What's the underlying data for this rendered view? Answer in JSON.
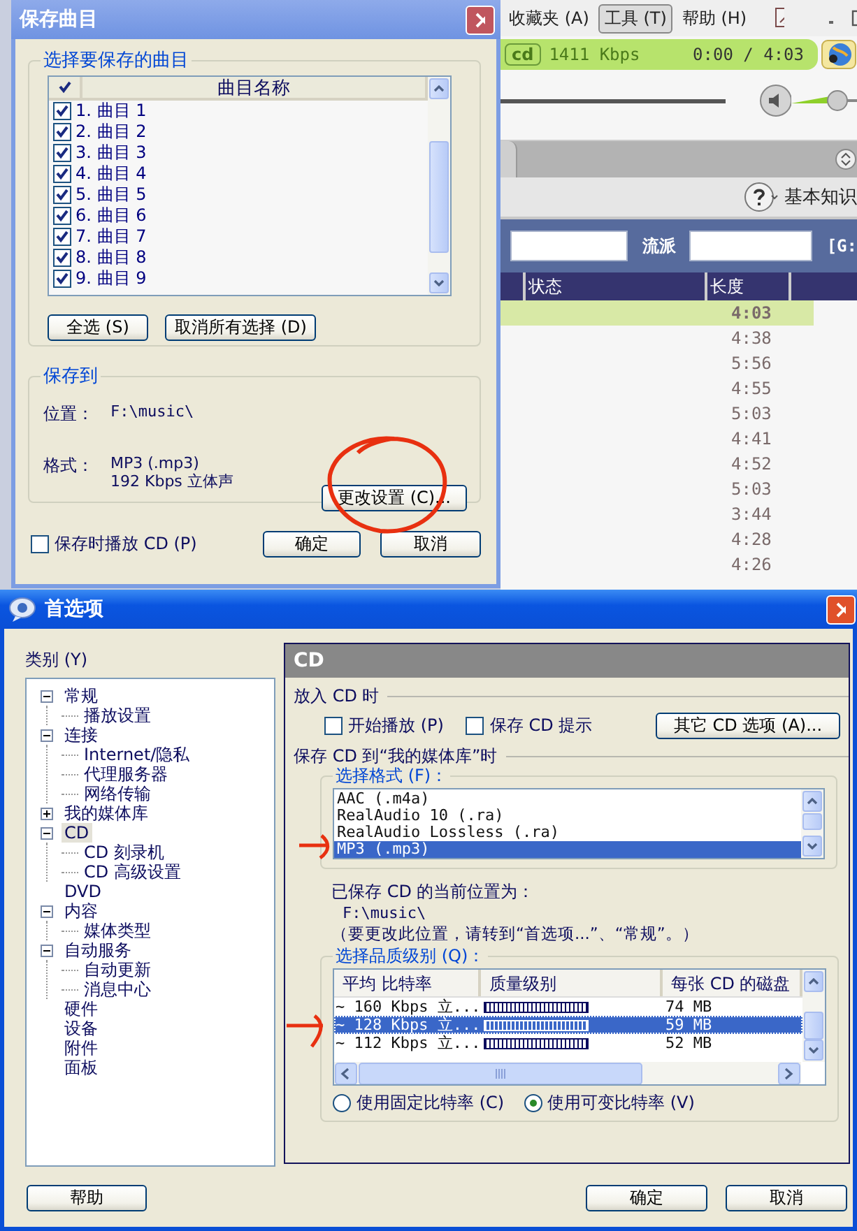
{
  "player": {
    "menu": [
      {
        "label": "收藏夹 (A)",
        "selected": false
      },
      {
        "label": "工具 (T)",
        "selected": true
      },
      {
        "label": "帮助 (H)",
        "selected": false
      }
    ],
    "now_playing": {
      "source": "cd",
      "bitrate": "1411 Kbps",
      "time": "0:00 / 4:03"
    },
    "help_label": "基本知识",
    "filter_label": "流派",
    "drive_label": "[G:",
    "table": {
      "columns": [
        "状态",
        "长度"
      ],
      "rows": [
        {
          "length": "4:03",
          "selected": true
        },
        {
          "length": "4:38",
          "selected": false
        },
        {
          "length": "5:56",
          "selected": false
        },
        {
          "length": "4:55",
          "selected": false
        },
        {
          "length": "5:03",
          "selected": false
        },
        {
          "length": "4:41",
          "selected": false
        },
        {
          "length": "4:52",
          "selected": false
        },
        {
          "length": "5:03",
          "selected": false
        },
        {
          "length": "3:44",
          "selected": false
        },
        {
          "length": "4:28",
          "selected": false
        },
        {
          "length": "4:26",
          "selected": false
        }
      ]
    }
  },
  "save_dialog": {
    "title": "保存曲目",
    "tracks_group": "选择要保存的曲目",
    "list_header": "曲目名称",
    "tracks": [
      {
        "label": "1. 曲目 1",
        "checked": true
      },
      {
        "label": "2. 曲目 2",
        "checked": true
      },
      {
        "label": "3. 曲目 3",
        "checked": true
      },
      {
        "label": "4. 曲目 4",
        "checked": true
      },
      {
        "label": "5. 曲目 5",
        "checked": true
      },
      {
        "label": "6. 曲目 6",
        "checked": true
      },
      {
        "label": "7. 曲目 7",
        "checked": true
      },
      {
        "label": "8. 曲目 8",
        "checked": true
      },
      {
        "label": "9. 曲目 9",
        "checked": true
      }
    ],
    "select_all": "全选 (S)",
    "deselect_all": "取消所有选择 (D)",
    "save_group": "保存到",
    "location_label": "位置：",
    "location": "F:\\music\\",
    "format_label": "格式：",
    "format": [
      "MP3 (.mp3)",
      "192 Kbps 立体声"
    ],
    "change_button": "更改设置 (C)...",
    "play_while_saving": {
      "label": "保存时播放 CD (P)",
      "checked": false
    },
    "ok": "确定",
    "cancel": "取消"
  },
  "preferences": {
    "title": "首选项",
    "category_label": "类别 (Y)",
    "tree": [
      {
        "label": "常规",
        "selected": false,
        "expanded": true,
        "children": [
          {
            "label": "播放设置",
            "selected": false
          }
        ]
      },
      {
        "label": "连接",
        "selected": false,
        "expanded": true,
        "children": [
          {
            "label": "Internet/隐私",
            "selected": false
          },
          {
            "label": "代理服务器",
            "selected": false
          },
          {
            "label": "网络传输",
            "selected": false
          }
        ]
      },
      {
        "label": "我的媒体库",
        "selected": false,
        "expanded": false
      },
      {
        "label": "CD",
        "selected": true,
        "expanded": true,
        "children": [
          {
            "label": "CD 刻录机",
            "selected": false
          },
          {
            "label": "CD 高级设置",
            "selected": false
          }
        ]
      },
      {
        "label": "DVD",
        "selected": false
      },
      {
        "label": "内容",
        "selected": false,
        "expanded": true,
        "children": [
          {
            "label": "媒体类型",
            "selected": false
          }
        ]
      },
      {
        "label": "自动服务",
        "selected": false,
        "expanded": true,
        "children": [
          {
            "label": "自动更新",
            "selected": false
          },
          {
            "label": "消息中心",
            "selected": false
          }
        ]
      },
      {
        "label": "硬件",
        "selected": false
      },
      {
        "label": "设备",
        "selected": false
      },
      {
        "label": "附件",
        "selected": false
      },
      {
        "label": "面板",
        "selected": false
      }
    ],
    "panel_title": "CD",
    "insert_section": "放入 CD 时",
    "insert_options": [
      {
        "label": "开始播放 (P)",
        "checked": false
      },
      {
        "label": "保存 CD 提示",
        "checked": false
      }
    ],
    "other_options_button": "其它 CD 选项 (A)...",
    "save_section": "保存 CD 到“我的媒体库”时",
    "format_group": "选择格式 (F)：",
    "formats": [
      {
        "label": "AAC (.m4a)",
        "selected": false
      },
      {
        "label": "RealAudio 10 (.ra)",
        "selected": false
      },
      {
        "label": "RealAudio Lossless (.ra)",
        "selected": false
      },
      {
        "label": "MP3 (.mp3)",
        "selected": true
      }
    ],
    "location_heading": "已保存 CD 的当前位置为：",
    "location": "F:\\music\\",
    "location_note": "（要更改此位置，请转到“首选项...”、“常规”。）",
    "quality_group": "选择品质级别 (Q)：",
    "quality_columns": [
      "平均 比特率",
      "质量级别",
      "每张 CD 的磁盘"
    ],
    "quality_rows": [
      {
        "bitrate": "~ 160 Kbps 立...",
        "size": "74 MB",
        "selected": false
      },
      {
        "bitrate": "~ 128 Kbps 立...",
        "size": "59 MB",
        "selected": true
      },
      {
        "bitrate": "~ 112 Kbps 立...",
        "size": "52 MB",
        "selected": false
      }
    ],
    "bitrate_modes": [
      {
        "label": "使用固定比特率 (C)",
        "selected": false
      },
      {
        "label": "使用可变比特率 (V)",
        "selected": true
      }
    ],
    "help": "帮助",
    "ok": "确定",
    "cancel": "取消"
  }
}
